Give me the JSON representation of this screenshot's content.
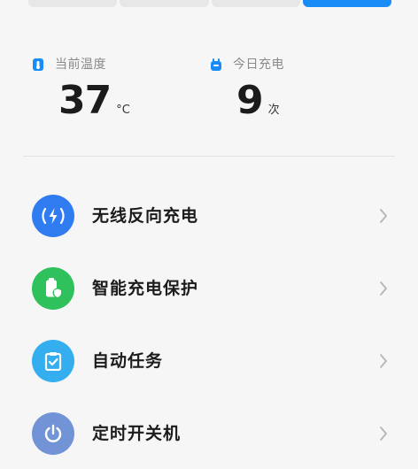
{
  "tabs": [
    {
      "label": "",
      "active": false
    },
    {
      "label": "",
      "active": false
    },
    {
      "label": "",
      "active": false
    },
    {
      "label": "",
      "active": true
    }
  ],
  "stats": {
    "temperature": {
      "label": "当前温度",
      "value": "37",
      "unit": "°C",
      "icon": "thermometer-icon",
      "color": "#1a8cf5"
    },
    "charge_count": {
      "label": "今日充电",
      "value": "9",
      "unit": "次",
      "icon": "plug-icon",
      "color": "#1a8cf5"
    }
  },
  "menu": {
    "items": [
      {
        "label": "无线反向充电",
        "icon": "wireless-charge-icon",
        "color": "#2f7bf0"
      },
      {
        "label": "智能充电保护",
        "icon": "battery-shield-icon",
        "color": "#2ec15c"
      },
      {
        "label": "自动任务",
        "icon": "clipboard-check-icon",
        "color": "#35aef0"
      },
      {
        "label": "定时开关机",
        "icon": "power-icon",
        "color": "#7294d6"
      }
    ]
  }
}
